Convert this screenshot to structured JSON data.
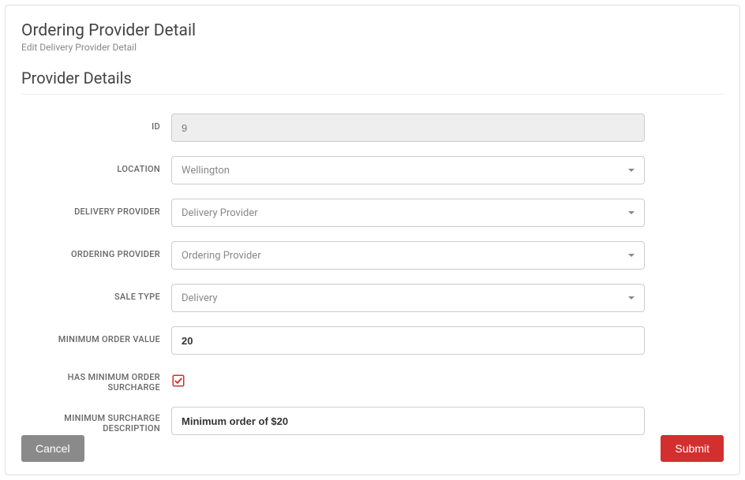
{
  "header": {
    "title": "Ordering Provider Detail",
    "subtitle": "Edit Delivery Provider Detail"
  },
  "section": {
    "title": "Provider Details"
  },
  "form": {
    "id": {
      "label": "ID",
      "value": "9"
    },
    "location": {
      "label": "LOCATION",
      "selected": "Wellington"
    },
    "delivery_provider": {
      "label": "DELIVERY PROVIDER",
      "selected": "Delivery Provider"
    },
    "ordering_provider": {
      "label": "ORDERING PROVIDER",
      "selected": "Ordering Provider"
    },
    "sale_type": {
      "label": "SALE TYPE",
      "selected": "Delivery"
    },
    "min_order_value": {
      "label": "MINIMUM ORDER VALUE",
      "value": "20"
    },
    "has_min_surcharge": {
      "label": "HAS MINIMUM ORDER SURCHARGE",
      "checked": true
    },
    "min_surcharge_desc": {
      "label": "MINIMUM SURCHARGE DESCRIPTION",
      "value": "Minimum order of $20"
    }
  },
  "buttons": {
    "cancel": "Cancel",
    "submit": "Submit"
  },
  "colors": {
    "accent": "#d32f2f",
    "muted": "#8a8a8a"
  }
}
